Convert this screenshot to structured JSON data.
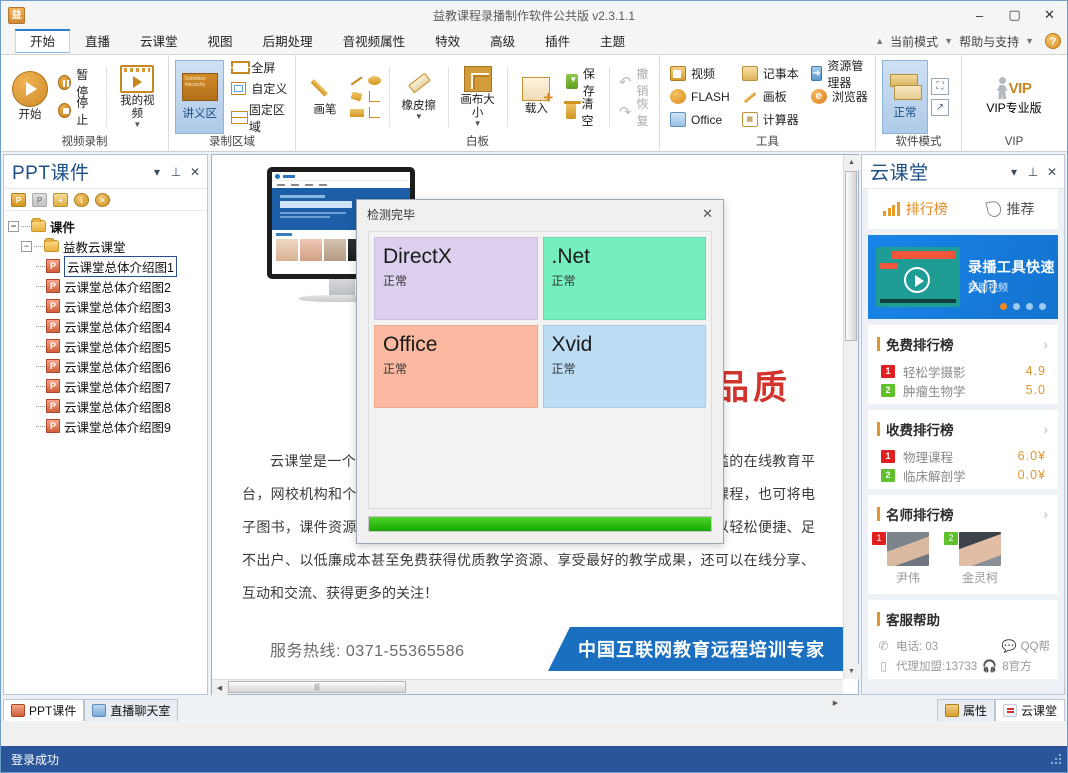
{
  "window": {
    "title": "益教课程录播制作软件公共版 v2.3.1.1",
    "app_icon": "app-logo-icon",
    "minimize": "–",
    "maximize": "▢",
    "close": "✕"
  },
  "ribbon": {
    "tabs": [
      {
        "label": "开始",
        "active": true
      },
      {
        "label": "直播",
        "active": false
      },
      {
        "label": "云课堂",
        "active": false
      },
      {
        "label": "视图",
        "active": false
      },
      {
        "label": "后期处理",
        "active": false
      },
      {
        "label": "音视频属性",
        "active": false
      },
      {
        "label": "特效",
        "active": false
      },
      {
        "label": "高级",
        "active": false
      },
      {
        "label": "插件",
        "active": false
      },
      {
        "label": "主题",
        "active": false
      }
    ],
    "right_items": {
      "current_mode": "当前模式",
      "help_support": "帮助与支持",
      "help_badge": "?"
    },
    "groups": {
      "record": {
        "title": "视频录制",
        "start": "开始",
        "pause": "暂停",
        "stop": "停止",
        "my_video": "我的视频"
      },
      "area": {
        "title": "录制区域",
        "lecture_area": "讲义区",
        "lecture_thumb_text": "Definition hierarchy",
        "fullscreen": "全屏",
        "custom": "自定义",
        "fixed_area": "固定区域"
      },
      "whiteboard": {
        "title": "白板",
        "pen": "画笔",
        "eraser": "橡皮擦",
        "canvas_size": "画布大小",
        "load": "载入",
        "save": "保存",
        "clear": "清空",
        "undo": "撤销",
        "redo": "恢复"
      },
      "tools": {
        "title": "工具",
        "items": [
          "视频",
          "记事本",
          "资源管理器",
          "FLASH",
          "画板",
          "浏览器",
          "Office",
          "计算器"
        ]
      },
      "software_mode": {
        "title": "软件模式",
        "normal": "正常"
      },
      "vip": {
        "title": "VIP",
        "label": "VIP专业版",
        "mark": "VIP"
      }
    }
  },
  "left_panel": {
    "title": "PPT课件",
    "header_buttons": [
      "▾",
      "⊥",
      "✕"
    ],
    "toolbar_icons": [
      "ppt-add-icon",
      "ppt-remove-icon",
      "folder-add-icon",
      "info-icon",
      "clear-icon"
    ],
    "tree": {
      "root": "课件",
      "group": "益教云课堂",
      "items": [
        "云课堂总体介绍图1",
        "云课堂总体介绍图2",
        "云课堂总体介绍图3",
        "云课堂总体介绍图4",
        "云课堂总体介绍图5",
        "云课堂总体介绍图6",
        "云课堂总体介绍图7",
        "云课堂总体介绍图8",
        "云课堂总体介绍图9"
      ],
      "selected_index": 0
    }
  },
  "slide": {
    "headline": "品质",
    "body": "云课堂是一个低成本、高品质的在线教育和知识分享。打破所有技术门槛的在线教育平台，网校机构和个人可使用益教在线录播制作软件在线直播教学、录制视频课程，也可将电子图书，课件资源，试题及相关技能等分享给求知者。求知者通过互联网可以轻松便捷、足不出户、以低廉成本甚至免费获得优质教学资源、享受最好的教学成果，还可以在线分享、互动和交流、获得更多的关注！",
    "hotline": "服务热线: 0371-55365586",
    "banner": "中国互联网教育远程培训专家"
  },
  "dialog": {
    "title": "检测完毕",
    "close": "✕",
    "progress_percent": 100,
    "tiles": [
      {
        "name": "DirectX",
        "status": "正常",
        "color": "#ddd0ef"
      },
      {
        "name": ".Net",
        "status": "正常",
        "color": "#76efbf"
      },
      {
        "name": "Office",
        "status": "正常",
        "color": "#fab9a0"
      },
      {
        "name": "Xvid",
        "status": "正常",
        "color": "#bcddf4"
      }
    ]
  },
  "right_panel": {
    "title": "云课堂",
    "header_buttons": [
      "▾",
      "⊥",
      "✕"
    ],
    "tabs": [
      {
        "label": "排行榜",
        "active": true,
        "icon": "bar-chart-icon"
      },
      {
        "label": "推荐",
        "active": false,
        "icon": "flame-icon"
      }
    ],
    "promo": {
      "title": "录播工具快速入门",
      "subtitle": "帮助视频",
      "dots": 4,
      "active_dot": 0
    },
    "sections": [
      {
        "title": "免费排行榜",
        "more": "›",
        "rows": [
          {
            "rank": "1",
            "name": "轻松学摄影",
            "value": "4.9"
          },
          {
            "rank": "2",
            "name": "肿瘤生物学",
            "value": "5.0"
          }
        ]
      },
      {
        "title": "收费排行榜",
        "more": "›",
        "rows": [
          {
            "rank": "1",
            "name": "物理课程",
            "value": "6.0¥"
          },
          {
            "rank": "2",
            "name": "临床解剖学",
            "value": "0.0¥"
          }
        ]
      }
    ],
    "teachers_section": {
      "title": "名师排行榜",
      "more": "›",
      "teachers": [
        {
          "rank": "1",
          "name": "尹伟"
        },
        {
          "rank": "2",
          "name": "金灵柯"
        }
      ]
    },
    "support": {
      "title": "客服帮助",
      "phone_label": "电话: 03",
      "qq_label": "QQ帮",
      "agent_label": "代理加盟:13733",
      "agent_extra": "8官方"
    }
  },
  "dock_tabs": {
    "left": [
      {
        "label": "PPT课件",
        "active": true,
        "icon": "ppt-icon"
      },
      {
        "label": "直播聊天室",
        "active": false,
        "icon": "chat-icon"
      }
    ],
    "right": [
      {
        "label": "属性",
        "active": false,
        "icon": "properties-icon"
      },
      {
        "label": "云课堂",
        "active": true,
        "icon": "cloud-class-icon"
      }
    ]
  },
  "statusbar": {
    "message": "登录成功"
  },
  "scrollbars": {
    "center_h_grip": "|||",
    "left_arrow": "◀",
    "right_arrow": "▶",
    "up_arrow": "▲",
    "down_arrow": "▼"
  }
}
